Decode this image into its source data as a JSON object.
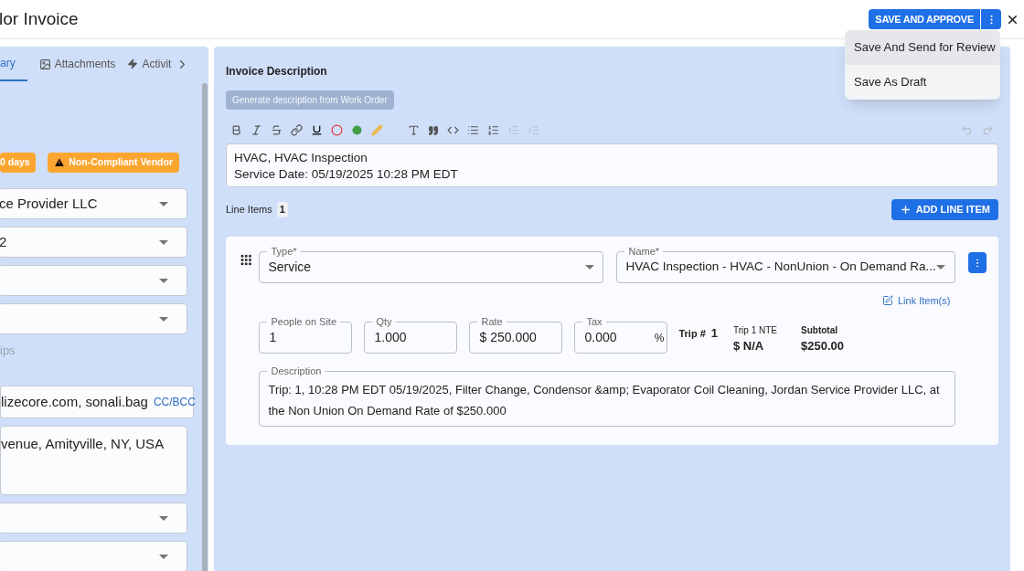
{
  "header": {
    "title": "lor Invoice",
    "primary_button": "SAVE AND APPROVE",
    "menu": [
      {
        "label": "Save And Send for Review",
        "selected": true
      },
      {
        "label": "Save As Draft",
        "selected": false
      }
    ]
  },
  "left_panel": {
    "tabs": [
      {
        "label": "ary",
        "selected": true,
        "kind": "plain"
      },
      {
        "label": "Attachments",
        "selected": false,
        "kind": "image"
      },
      {
        "label": "Activit",
        "selected": false,
        "kind": "bolt"
      }
    ],
    "badges": [
      {
        "label": "0 days",
        "kind": "plain"
      },
      {
        "label": "Non-Compliant Vendor",
        "kind": "warning"
      }
    ],
    "fields": [
      {
        "kind": "select",
        "value": "ce Provider LLC"
      },
      {
        "kind": "select",
        "value": "2"
      },
      {
        "kind": "select"
      },
      {
        "kind": "select"
      },
      {
        "kind": "hint",
        "text": "ips"
      },
      {
        "kind": "email",
        "value": "lizecore.com, sonali.bag",
        "link": "CC/BCC"
      },
      {
        "kind": "textarea",
        "value": "venue, Amityville, NY, USA"
      },
      {
        "kind": "select"
      },
      {
        "kind": "select"
      }
    ]
  },
  "invoice_description": {
    "title": "Invoice Description",
    "generate_button": {
      "label": "Generate description from Work Order",
      "disabled": true
    },
    "text_lines": [
      "HVAC, HVAC Inspection",
      "Service Date: 05/19/2025 10:28 PM EDT"
    ]
  },
  "line_items": {
    "label": "Line Items",
    "count": "1",
    "add_button": "ADD LINE ITEM",
    "items": [
      {
        "type_label": "Type*",
        "type": "Service",
        "name_label": "Name*",
        "name": "HVAC Inspection - HVAC - NonUnion - On Demand Ra...",
        "link": "Link Item(s)",
        "fields": [
          {
            "label": "People on Site",
            "value": "1"
          },
          {
            "label": "Qty",
            "value": "1.000"
          },
          {
            "label": "Rate",
            "value": "$ 250.000"
          },
          {
            "label": "Tax",
            "value": "0.000",
            "suffix": "%"
          }
        ],
        "trip_label": "Trip #",
        "trip": "1",
        "nte_label": "Trip 1 NTE",
        "nte": "$ N/A",
        "subtotal_label": "Subtotal",
        "subtotal": "$250.00",
        "description_label": "Description",
        "description": "Trip: 1, 10:28 PM EDT 05/19/2025, Filter Change, Condensor &amp; Evaporator Coil Cleaning, Jordan Service Provider LLC, at the Non Union On Demand Rate of $250.000"
      }
    ]
  }
}
